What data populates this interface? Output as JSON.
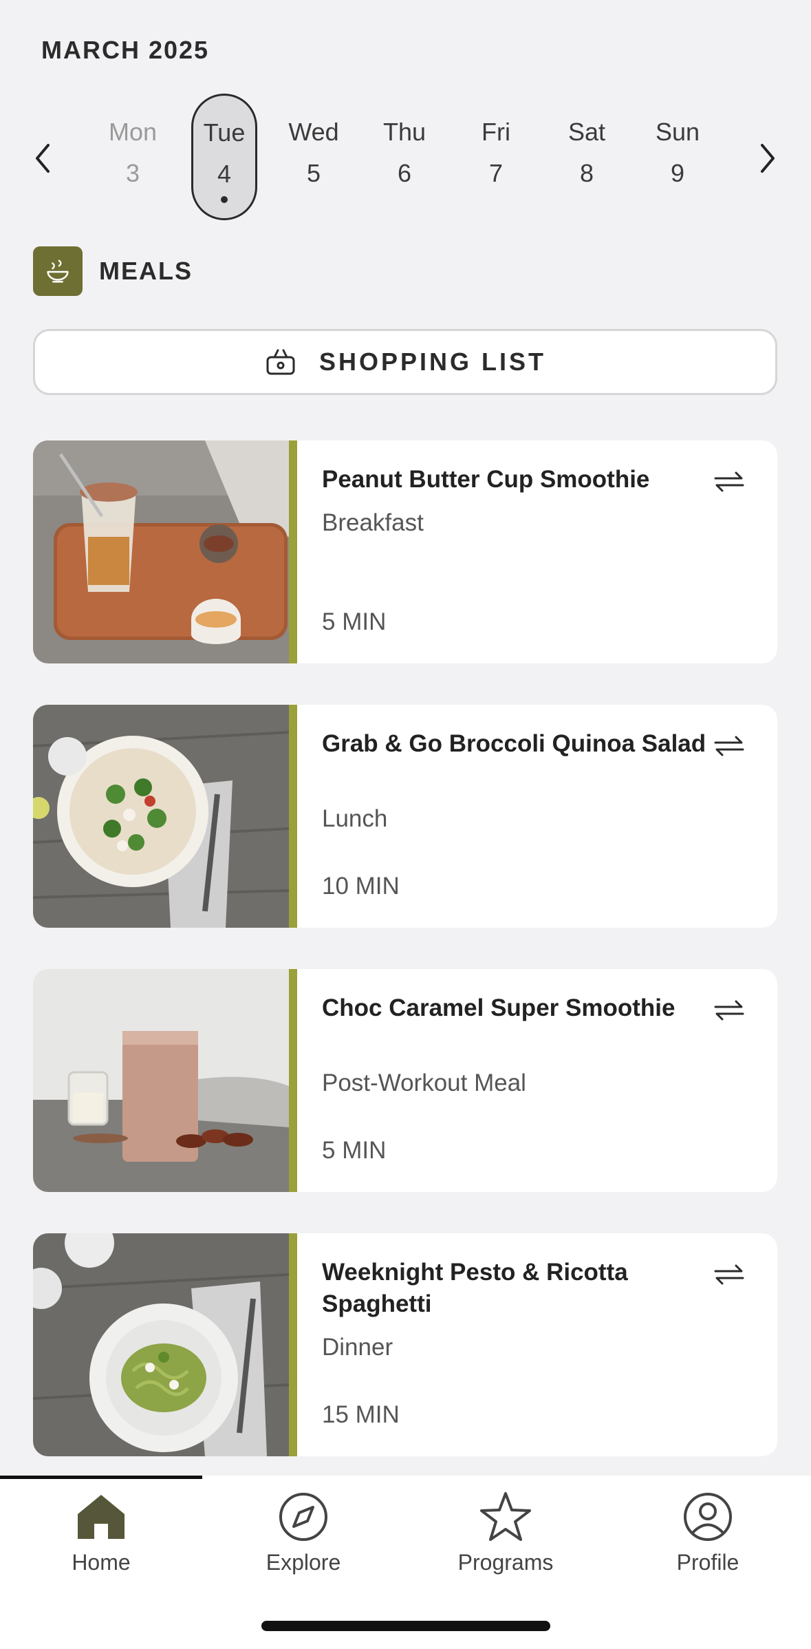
{
  "calendar": {
    "month": "MARCH 2025",
    "days": [
      {
        "name": "Mon",
        "date": "3"
      },
      {
        "name": "Tue",
        "date": "4"
      },
      {
        "name": "Wed",
        "date": "5"
      },
      {
        "name": "Thu",
        "date": "6"
      },
      {
        "name": "Fri",
        "date": "7"
      },
      {
        "name": "Sat",
        "date": "8"
      },
      {
        "name": "Sun",
        "date": "9"
      }
    ]
  },
  "meals": {
    "section_label": "MEALS",
    "shopping_list_label": "SHOPPING LIST",
    "items": [
      {
        "title": "Peanut Butter Cup Smoothie",
        "type": "Breakfast",
        "time": "5 MIN"
      },
      {
        "title": "Grab & Go Broccoli Quinoa Salad",
        "type": "Lunch",
        "time": "10 MIN"
      },
      {
        "title": "Choc Caramel Super Smoothie",
        "type": "Post-Workout Meal",
        "time": "5 MIN"
      },
      {
        "title": "Weeknight Pesto & Ricotta Spaghetti",
        "type": "Dinner",
        "time": "15 MIN"
      }
    ]
  },
  "tabs": [
    {
      "label": "Home"
    },
    {
      "label": "Explore"
    },
    {
      "label": "Programs"
    },
    {
      "label": "Profile"
    }
  ],
  "colors": {
    "accent": "#9aa03a",
    "meals_icon_bg": "#6e6f32"
  }
}
